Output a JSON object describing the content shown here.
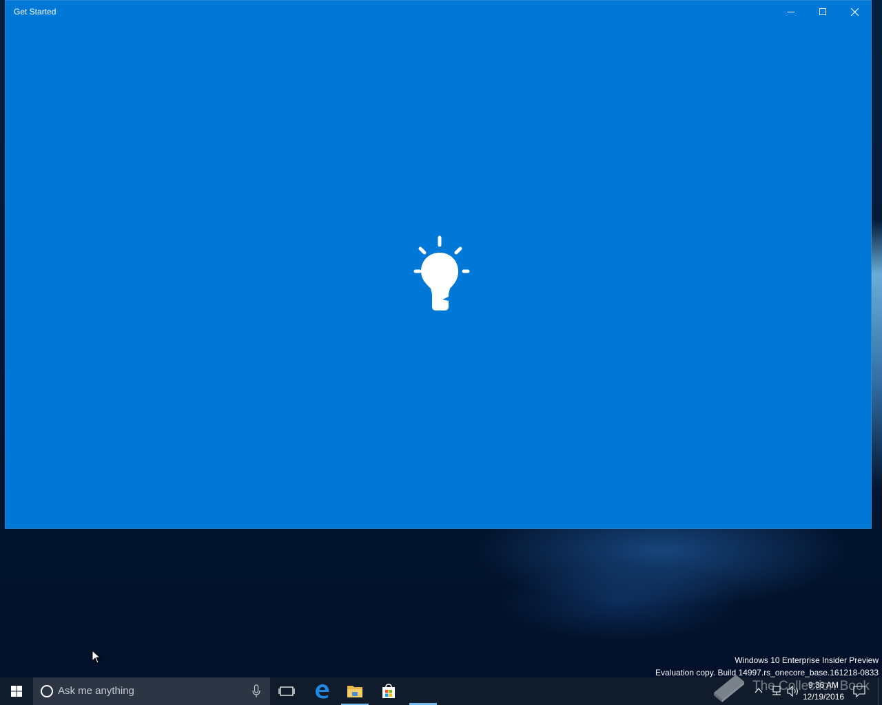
{
  "window": {
    "title": "Get Started",
    "controls": [
      "minimize-icon",
      "maximize-icon",
      "close-icon"
    ],
    "background_color": "#0078d7",
    "splash_icon": "lightbulb-icon"
  },
  "desktop": {
    "watermark": {
      "line1": "Windows 10 Enterprise Insider Preview",
      "line2": "Evaluation copy. Build 14997.rs_onecore_base.161218-0833"
    },
    "overlay_logo_text": "The Collection Book"
  },
  "taskbar": {
    "search": {
      "placeholder": "Ask me anything"
    },
    "pinned_apps": [
      "task-view-icon",
      "edge-icon",
      "file-explorer-icon",
      "store-icon"
    ],
    "clock": {
      "time": "9:36 AM",
      "date": "12/19/2016"
    },
    "accent_color": "#76b9ed"
  }
}
